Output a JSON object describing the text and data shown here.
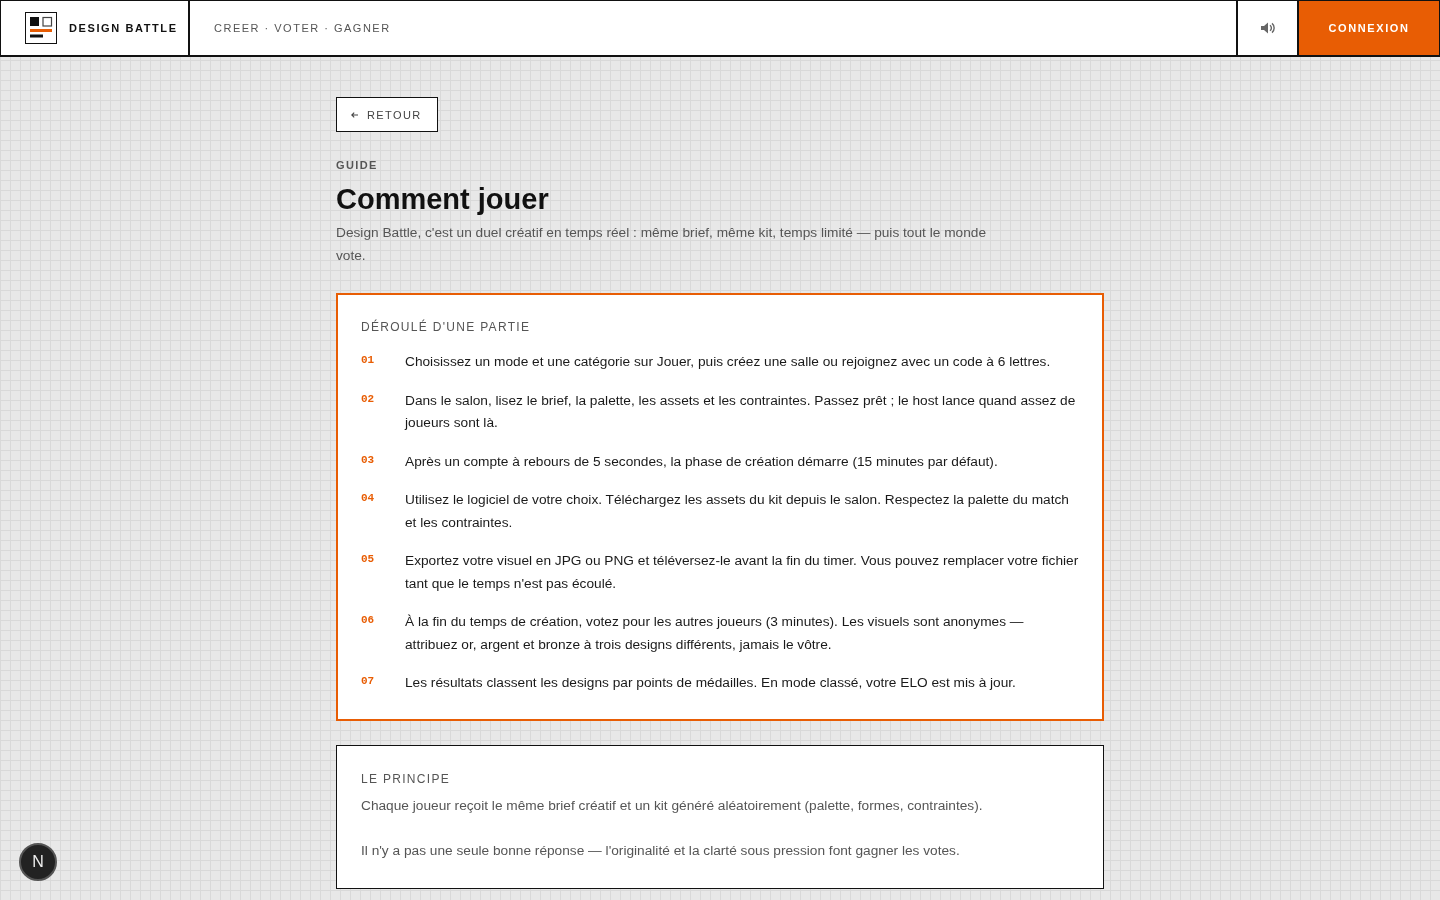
{
  "header": {
    "brand": "DESIGN BATTLE",
    "tagline": "CREER · VOTER · GAGNER",
    "login_button": "CONNEXION"
  },
  "back_button": {
    "label": "RETOUR"
  },
  "eyebrow": "GUIDE",
  "title": "Comment jouer",
  "intro": "Design Battle, c'est un duel créatif en temps réel : même brief, même kit, temps limité — puis tout le monde vote.",
  "steps_card": {
    "heading": "DÉROULÉ D'UNE PARTIE",
    "steps": [
      {
        "number": "01",
        "text": "Choisissez un mode et une catégorie sur Jouer, puis créez une salle ou rejoignez avec un code à 6 lettres."
      },
      {
        "number": "02",
        "text": "Dans le salon, lisez le brief, la palette, les assets et les contraintes. Passez prêt ; le host lance quand assez de joueurs sont là."
      },
      {
        "number": "03",
        "text": "Après un compte à rebours de 5 secondes, la phase de création démarre (15 minutes par défaut)."
      },
      {
        "number": "04",
        "text": "Utilisez le logiciel de votre choix. Téléchargez les assets du kit depuis le salon. Respectez la palette du match et les contraintes."
      },
      {
        "number": "05",
        "text": "Exportez votre visuel en JPG ou PNG et téléversez-le avant la fin du timer. Vous pouvez remplacer votre fichier tant que le temps n'est pas écoulé."
      },
      {
        "number": "06",
        "text": "À la fin du temps de création, votez pour les autres joueurs (3 minutes). Les visuels sont anonymes — attribuez or, argent et bronze à trois designs différents, jamais le vôtre."
      },
      {
        "number": "07",
        "text": "Les résultats classent les designs par points de médailles. En mode classé, votre ELO est mis à jour."
      }
    ]
  },
  "principle_card": {
    "heading": "LE PRINCIPE",
    "paragraphs": [
      "Chaque joueur reçoit le même brief créatif et un kit généré aléatoirement (palette, formes, contraintes).",
      "Il n'y a pas une seule bonne réponse — l'originalité et la clarté sous pression font gagner les votes."
    ]
  },
  "dev_badge": {
    "label": "N"
  }
}
